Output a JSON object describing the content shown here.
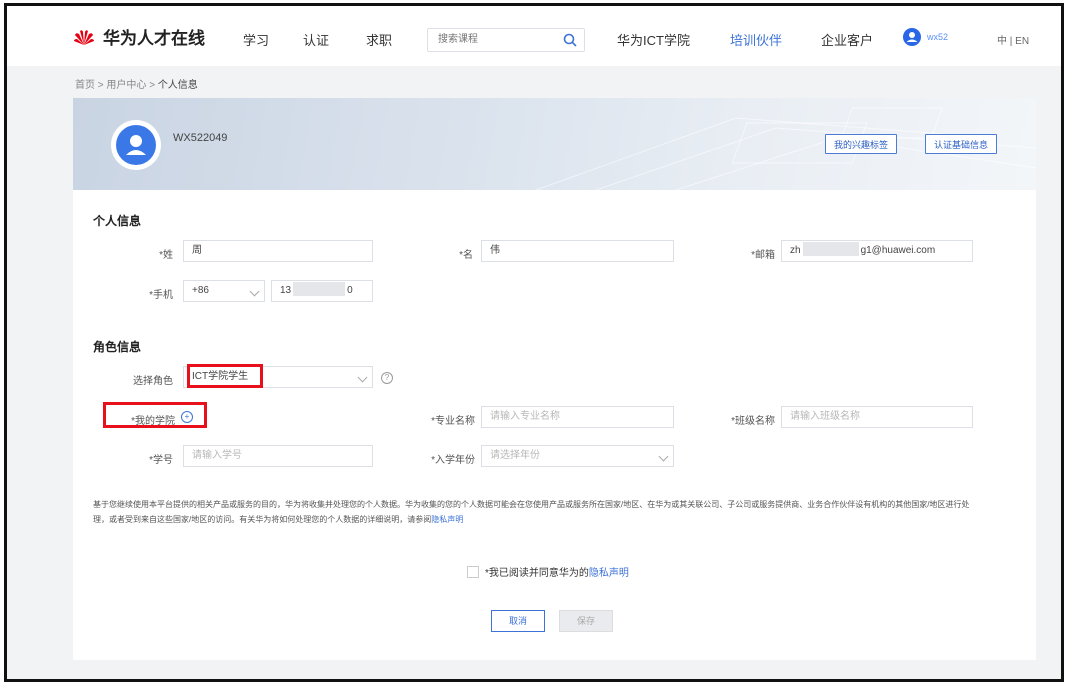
{
  "nav": {
    "brand": "华为人才在线",
    "links": [
      "学习",
      "认证",
      "求职"
    ],
    "search_placeholder": "搜索课程",
    "right_links": [
      "华为ICT学院",
      "培训伙伴",
      "企业客户"
    ],
    "user_short": "wx52",
    "lang": "中 | EN",
    "active_color": "#3d73d8"
  },
  "breadcrumb": {
    "items": [
      "首页",
      "用户中心",
      "个人信息"
    ],
    "separator": ">"
  },
  "profile": {
    "username": "WX522049",
    "buttons": [
      "我的兴趣标签",
      "认证基础信息"
    ]
  },
  "personal": {
    "title": "个人信息",
    "surname_label": "*姓",
    "surname_value": "周",
    "given_label": "*名",
    "given_value": "伟",
    "email_label": "*邮箱",
    "email_value": "zh",
    "email_value_tail": "g1@huawei.com",
    "phone_label": "*手机",
    "phone_code": "+86",
    "phone_value": "13",
    "phone_value_tail": "0"
  },
  "role": {
    "title": "角色信息",
    "select_label": "选择角色",
    "select_value": "ICT学院学生",
    "college_label": "*我的学院",
    "major_label": "*专业名称",
    "major_placeholder": "请输入专业名称",
    "class_label": "*班级名称",
    "class_placeholder": "请输入班级名称",
    "student_no_label": "*学号",
    "student_no_placeholder": "请输入学号",
    "year_label": "*入学年份",
    "year_placeholder": "请选择年份"
  },
  "consent": {
    "text": "基于您继续使用本平台提供的相关产品或服务的目的，华为将收集并处理您的个人数据。华为收集的您的个人数据可能会在您使用产品或服务所在国家/地区、在华为或其关联公司、子公司或服务提供商、业务合作伙伴设有机构的其他国家/地区进行处理，或者受到来自这些国家/地区的访问。有关华为将如何处理您的个人数据的详细说明，请参阅",
    "link": "隐私声明"
  },
  "agree": {
    "prefix": "*我已阅读并同意华为的",
    "link": "隐私声明"
  },
  "buttons": {
    "cancel": "取消",
    "save": "保存"
  }
}
